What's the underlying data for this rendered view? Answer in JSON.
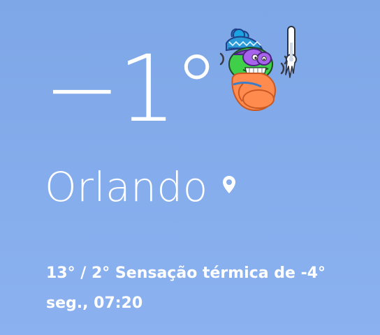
{
  "colors": {
    "background_top": "#7ea7e7",
    "background_bottom": "#8bb1f0",
    "text": "#ffffff"
  },
  "weather": {
    "temperature": "−1°",
    "city": "Orlando",
    "details": "13° / 2° Sensação térmica de -4°",
    "time": "seg., 07:20",
    "icons": {
      "location": "location-pin-icon",
      "illustration": "cold-frog-mascot-icon"
    }
  }
}
